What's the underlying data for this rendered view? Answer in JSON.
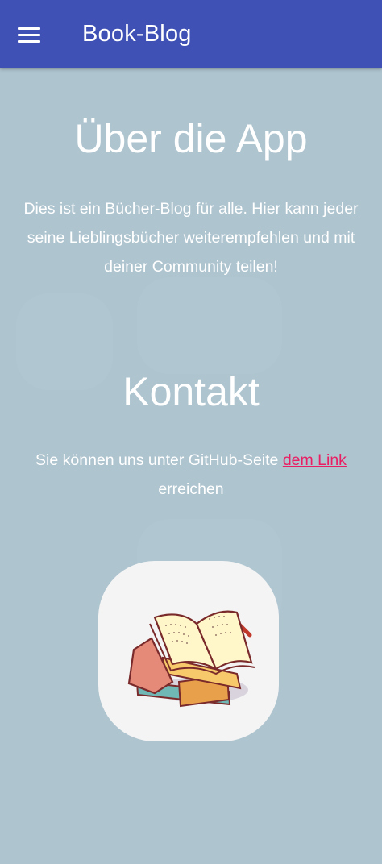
{
  "appbar": {
    "title": "Book-Blog",
    "menu_icon": "hamburger-menu-icon",
    "background": "#3f51b5"
  },
  "about": {
    "heading": "Über die App",
    "text": "Dies ist ein Bücher-Blog für alle. Hier kann jeder seine Lieblingsbücher weiterempfehlen und mit deiner Community teilen!"
  },
  "contact": {
    "heading": "Kontakt",
    "text_before": "Sie können uns unter GitHub-Seite ",
    "link_text": "dem Link",
    "text_after": " erreichen"
  },
  "logo": {
    "icon": "books-logo-icon"
  },
  "colors": {
    "page_background": "#aec4cf",
    "link": "#e91e63",
    "text": "#ffffff"
  }
}
